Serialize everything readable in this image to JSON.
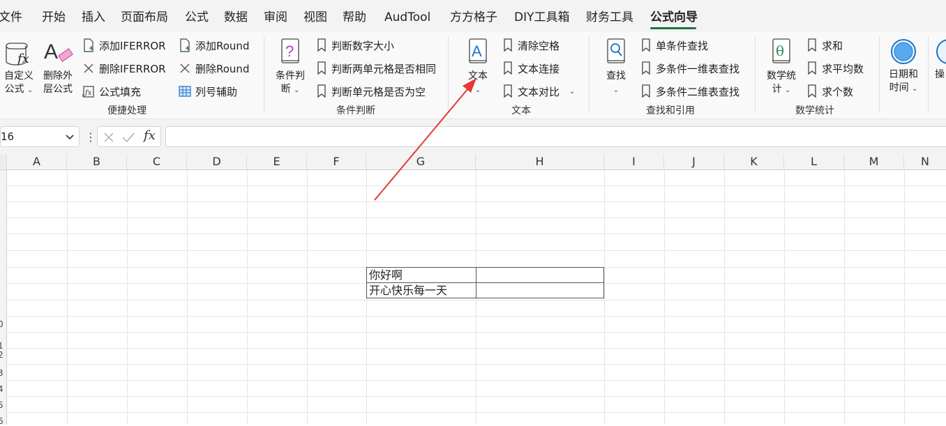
{
  "menu": {
    "items": [
      "文件",
      "开始",
      "插入",
      "页面布局",
      "公式",
      "数据",
      "审阅",
      "视图",
      "帮助",
      "AudTool",
      "方方格子",
      "DIY工具箱",
      "财务工具",
      "公式向导"
    ],
    "active": "公式向导"
  },
  "ribbon": {
    "quick": {
      "custom_formula": [
        "自定义",
        "公式"
      ],
      "remove_outer": [
        "删除外",
        "层公式"
      ],
      "add_iferror": "添加IFERROR",
      "remove_iferror": "删除IFERROR",
      "formula_fill": "公式填充",
      "add_round": "添加Round",
      "remove_round": "删除Round",
      "col_assist": "列号辅助",
      "label": "便捷处理"
    },
    "condition": {
      "big": [
        "条件判",
        "断"
      ],
      "judge_size": "判断数字大小",
      "judge_same": "判断两单元格是否相同",
      "judge_empty": "判断单元格是否为空",
      "label": "条件判断"
    },
    "text": {
      "big": "文本",
      "clear_space": "清除空格",
      "concat": "文本连接",
      "compare": "文本对比",
      "label": "文本"
    },
    "lookup": {
      "big": "查找",
      "single": "单条件查找",
      "multi_1d": "多条件一维表查找",
      "multi_2d": "多条件二维表查找",
      "label": "查找和引用"
    },
    "math": {
      "big": [
        "数学统",
        "计"
      ],
      "sum": "求和",
      "avg": "求平均数",
      "count": "求个数",
      "label": "数学统计"
    },
    "date": {
      "big": [
        "日期和",
        "时间"
      ]
    },
    "partial_label": "操"
  },
  "formula_bar": {
    "name_box": "16",
    "fx": "fx",
    "formula": ""
  },
  "grid": {
    "columns": [
      "A",
      "B",
      "C",
      "D",
      "E",
      "F",
      "G",
      "H",
      "I",
      "J",
      "K",
      "L",
      "M",
      "N"
    ],
    "cells": {
      "g1": "你好啊",
      "g2": "开心快乐每一天",
      "h1": "",
      "h2": ""
    },
    "row_fragments": [
      "0",
      "1",
      "2",
      "3",
      "4",
      "5",
      "6"
    ]
  },
  "colors": {
    "accent": "#1e7145",
    "arrow": "#e53935",
    "icon_blue": "#1a73c9",
    "icon_purple": "#b03cc8",
    "icon_green": "#2e8b57"
  }
}
